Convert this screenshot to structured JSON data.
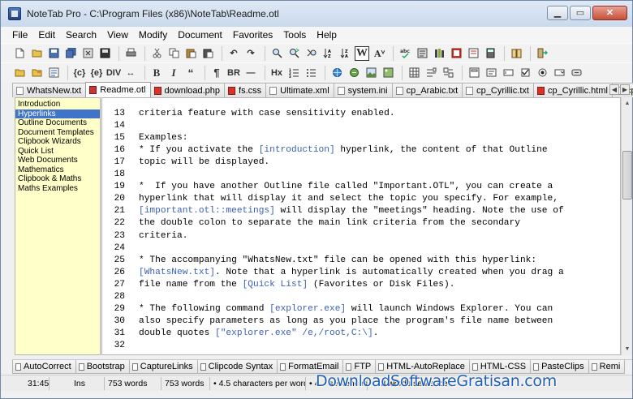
{
  "window": {
    "title": "NoteTab Pro  -  C:\\Program Files (x86)\\NoteTab\\Readme.otl",
    "controls": {
      "minimize": "▁",
      "maximize": "▭",
      "close": "✕"
    }
  },
  "menu": [
    "File",
    "Edit",
    "Search",
    "View",
    "Modify",
    "Document",
    "Favorites",
    "Tools",
    "Help"
  ],
  "toolbar2_labels": {
    "insert_braces": "{c}",
    "insert_tags": "{e}",
    "div": "DIV",
    "arrows": "↔",
    "bold": "B",
    "italic": "I",
    "quote": "“",
    "para": "¶",
    "br": "BR",
    "hr": "—",
    "hx": "Hx",
    "word_w": "W"
  },
  "doc_tabs": [
    {
      "label": "WhatsNew.txt",
      "active": false
    },
    {
      "label": "Readme.otl",
      "active": true
    },
    {
      "label": "download.php",
      "active": false
    },
    {
      "label": "fs.css",
      "active": false
    },
    {
      "label": "Ultimate.xml",
      "active": false
    },
    {
      "label": "system.ini",
      "active": false
    },
    {
      "label": "cp_Arabic.txt",
      "active": false
    },
    {
      "label": "cp_Cyrillic.txt",
      "active": false
    },
    {
      "label": "cp_Cyrillic.html",
      "active": false
    },
    {
      "label": "cp_Gre",
      "active": false
    }
  ],
  "outline": [
    {
      "label": "Introduction",
      "selected": false
    },
    {
      "label": "Hyperlinks",
      "selected": true
    },
    {
      "label": "Outline Documents",
      "selected": false
    },
    {
      "label": "Document Templates",
      "selected": false
    },
    {
      "label": "Clipbook Wizards",
      "selected": false
    },
    {
      "label": "Quick List",
      "selected": false
    },
    {
      "label": "Web Documents",
      "selected": false
    },
    {
      "label": "Mathematics",
      "selected": false
    },
    {
      "label": "Clipbook & Maths",
      "selected": false
    },
    {
      "label": "Maths Examples",
      "selected": false
    }
  ],
  "editor_lines": [
    {
      "n": "13",
      "parts": [
        {
          "t": "criteria feature with case sensitivity enabled."
        }
      ]
    },
    {
      "n": "14",
      "parts": []
    },
    {
      "n": "15",
      "parts": [
        {
          "t": "Examples:"
        }
      ]
    },
    {
      "n": "16",
      "parts": [
        {
          "t": "* If you activate the "
        },
        {
          "t": "[introduction]",
          "link": true
        },
        {
          "t": " hyperlink, the content of that Outline"
        }
      ]
    },
    {
      "n": "17",
      "parts": [
        {
          "t": "topic will be displayed."
        }
      ]
    },
    {
      "n": "18",
      "parts": []
    },
    {
      "n": "19",
      "parts": [
        {
          "t": "*  If you have another Outline file called \"Important.OTL\", you can create a"
        }
      ]
    },
    {
      "n": "20",
      "parts": [
        {
          "t": "hyperlink that will display it and select the topic you specify. For example,"
        }
      ]
    },
    {
      "n": "21",
      "parts": [
        {
          "t": "[important.otl::meetings]",
          "link": true
        },
        {
          "t": " will display the \"meetings\" heading. Note the use of"
        }
      ]
    },
    {
      "n": "22",
      "parts": [
        {
          "t": "the double colon to separate the main link criteria from the secondary"
        }
      ]
    },
    {
      "n": "23",
      "parts": [
        {
          "t": "criteria."
        }
      ]
    },
    {
      "n": "24",
      "parts": []
    },
    {
      "n": "25",
      "parts": [
        {
          "t": "* The accompanying \"WhatsNew.txt\" file can be opened with this hyperlink:"
        }
      ]
    },
    {
      "n": "26",
      "parts": [
        {
          "t": "[WhatsNew.txt]",
          "link": true
        },
        {
          "t": ". Note that a hyperlink is automatically created when you drag a"
        }
      ]
    },
    {
      "n": "27",
      "parts": [
        {
          "t": "file name from the "
        },
        {
          "t": "[Quick List]",
          "link": true
        },
        {
          "t": " (Favorites or Disk Files)."
        }
      ]
    },
    {
      "n": "28",
      "parts": []
    },
    {
      "n": "29",
      "parts": [
        {
          "t": "* The following command "
        },
        {
          "t": "[explorer.exe]",
          "link": true
        },
        {
          "t": " will launch Windows Explorer. You can"
        }
      ]
    },
    {
      "n": "30",
      "parts": [
        {
          "t": "also specify parameters as long as you place the program's file name between"
        }
      ]
    },
    {
      "n": "31",
      "parts": [
        {
          "t": "double quotes "
        },
        {
          "t": "[\"explorer.exe\" /e,/root,C:\\]",
          "link": true
        },
        {
          "t": "."
        }
      ]
    },
    {
      "n": "32",
      "parts": []
    }
  ],
  "clip_tabs": [
    "AutoCorrect",
    "Bootstrap",
    "CaptureLinks",
    "Clipcode Syntax",
    "FormatEmail",
    "FTP",
    "HTML-AutoReplace",
    "HTML-CSS",
    "PasteClips",
    "Remi"
  ],
  "status": {
    "position": "31:45",
    "mode": "Ins",
    "words_total": "753 words",
    "words_selection": "753 words",
    "chars_per_word": "• 4.5 characters per word",
    "sentences": "• 4... sentences",
    "words_sentence": "• 18 words/sentence"
  },
  "watermark": "DownloadSoftwareGratisan.com",
  "colors": {
    "link": "#3a5fb7",
    "outline_bg": "#ffffc9",
    "outline_selected": "#3f74c8",
    "watermark": "#1d5fb5"
  }
}
